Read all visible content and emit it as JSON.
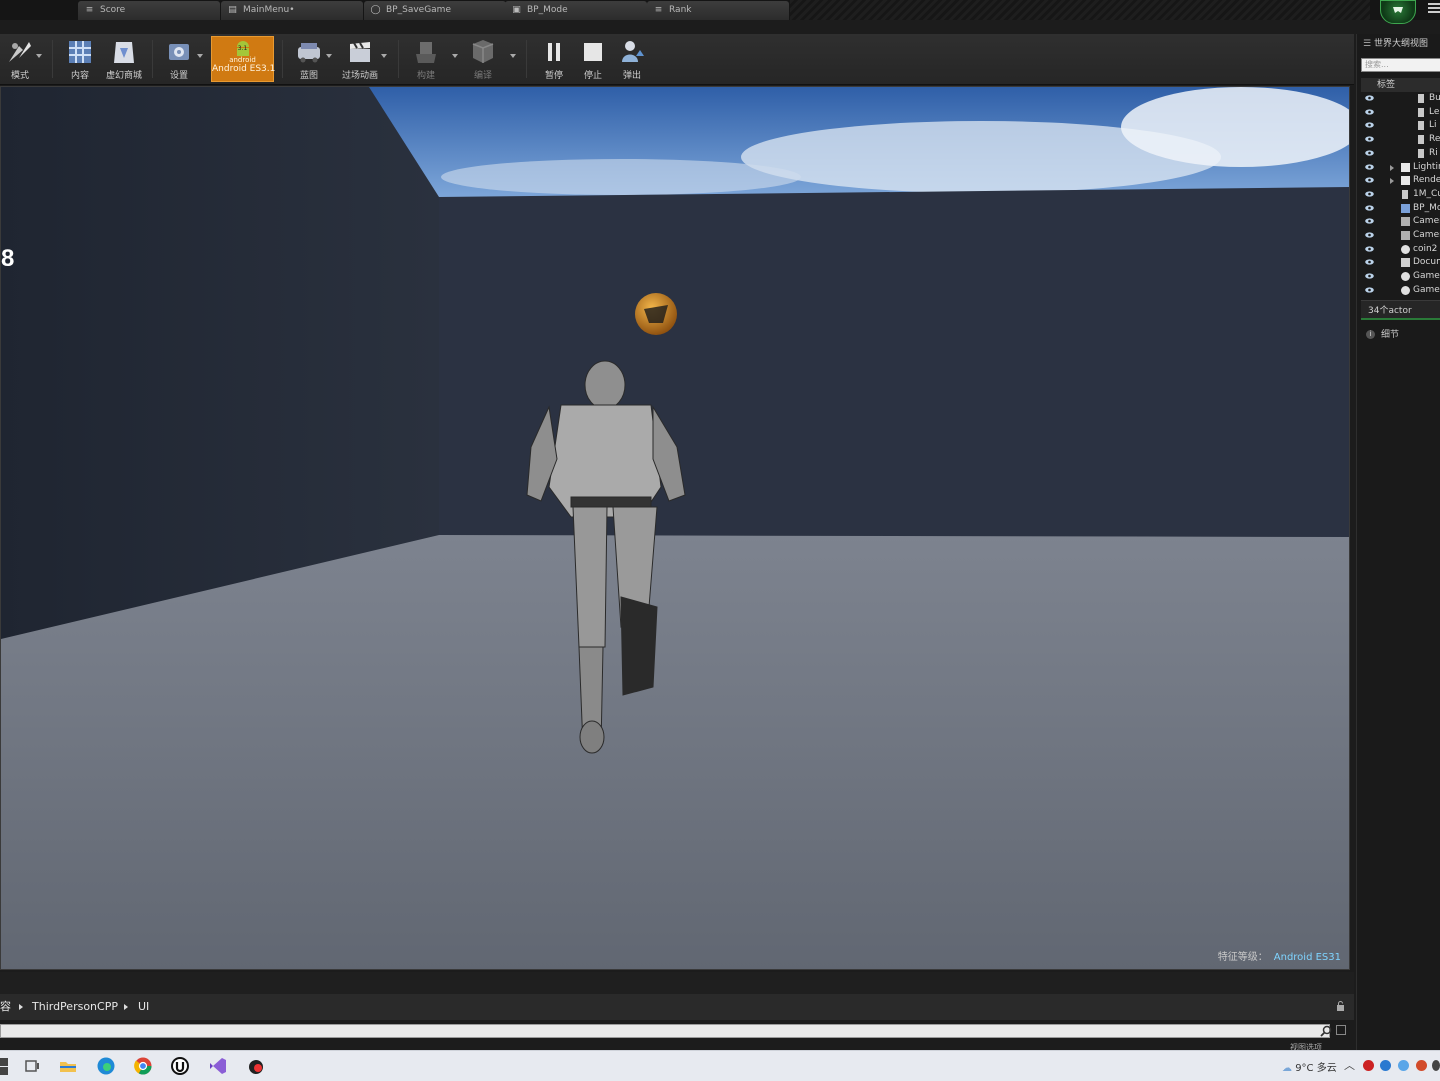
{
  "tabs": [
    {
      "label": "Score",
      "icon": "blueprint-icon"
    },
    {
      "label": "MainMenu•",
      "icon": "widget-icon"
    },
    {
      "label": "BP_SaveGame",
      "icon": "savegame-icon"
    },
    {
      "label": "BP_Mode",
      "icon": "gamemode-icon"
    },
    {
      "label": "Rank",
      "icon": "blueprint-icon"
    }
  ],
  "toolbar": {
    "modes": "模式",
    "content": "内容",
    "marketplace": "虚幻商城",
    "settings": "设置",
    "android_badge_top": "3.1",
    "android_badge_word": "android",
    "android_label": "Android ES3.1",
    "blueprints": "蓝图",
    "cinematics": "过场动画",
    "build": "构建",
    "compile": "编译",
    "pause": "暂停",
    "stop": "停止",
    "eject": "弹出"
  },
  "viewport": {
    "score": "8",
    "feature_level_label": "特征等级：",
    "feature_level_value": "Android ES31"
  },
  "content_browser": {
    "path": [
      "容",
      "ThirdPersonCPP",
      "UI"
    ],
    "view_options": "视图选项"
  },
  "outliner": {
    "title": "世界大纲视图",
    "search_placeholder": "搜索...",
    "column_label": "标签",
    "rows": [
      {
        "label": "Bu",
        "icon": "actor-icon",
        "indent": 2
      },
      {
        "label": "Le",
        "icon": "actor-icon",
        "indent": 2
      },
      {
        "label": "Li",
        "icon": "actor-icon",
        "indent": 2
      },
      {
        "label": "Re",
        "icon": "actor-icon",
        "indent": 2
      },
      {
        "label": "Ri",
        "icon": "actor-icon",
        "indent": 2
      },
      {
        "label": "Lightin",
        "icon": "folder-icon",
        "indent": 1
      },
      {
        "label": "Render",
        "icon": "folder-icon",
        "indent": 1
      },
      {
        "label": "1M_Cu",
        "icon": "actor-icon",
        "indent": 1
      },
      {
        "label": "BP_Mo",
        "icon": "blueprint-icon",
        "indent": 1
      },
      {
        "label": "Camer",
        "icon": "camera-icon",
        "indent": 1
      },
      {
        "label": "Camer",
        "icon": "camera-icon",
        "indent": 1
      },
      {
        "label": "coin2",
        "icon": "sphere-icon",
        "indent": 1
      },
      {
        "label": "Docum",
        "icon": "document-icon",
        "indent": 1
      },
      {
        "label": "GameM",
        "icon": "sphere-icon",
        "indent": 1
      },
      {
        "label": "GameS",
        "icon": "sphere-icon",
        "indent": 1
      }
    ],
    "actor_count": "34个actor",
    "details_tab": "细节"
  },
  "taskbar": {
    "weather": "9°C 多云",
    "apps": [
      "start-icon",
      "task-view-icon",
      "file-explorer-icon",
      "edge-icon",
      "chrome-icon",
      "unreal-icon",
      "visual-studio-icon",
      "app-icon"
    ]
  },
  "colors": {
    "android_accent": "#d07a12",
    "feature_value": "#7fd4ff",
    "ue_green": "#2a7a38"
  }
}
